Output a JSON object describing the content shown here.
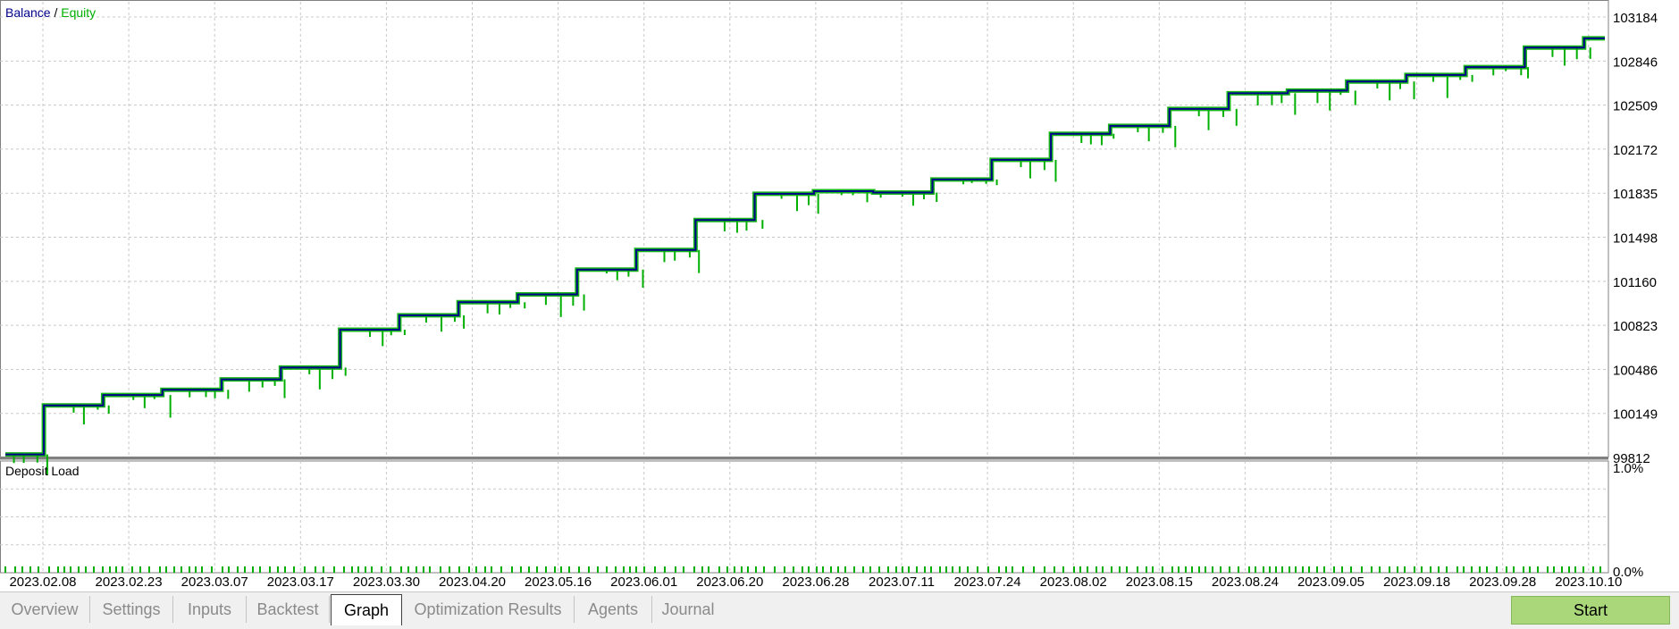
{
  "chart": {
    "legend": {
      "balance": "Balance",
      "sep": " / ",
      "equity": "Equity"
    },
    "colors": {
      "balance": "#00008b",
      "equity": "#00b000",
      "grid": "#c8c8c8",
      "separator": "#808080"
    },
    "subpanel_title": "Deposit Load",
    "subpanel_scale": [
      "1.0%",
      "0.0%"
    ]
  },
  "chart_data": {
    "type": "line",
    "series": [
      {
        "name": "Balance",
        "color": "#00008b"
      },
      {
        "name": "Equity",
        "color": "#00b000"
      }
    ],
    "y_ticks": [
      103184,
      102846,
      102509,
      102172,
      101835,
      101498,
      101160,
      100823,
      100486,
      100149,
      99812
    ],
    "ylim": [
      99812,
      103300
    ],
    "x_ticks": [
      "2023.02.08",
      "2023.02.23",
      "2023.03.07",
      "2023.03.17",
      "2023.03.30",
      "2023.04.20",
      "2023.05.16",
      "2023.06.01",
      "2023.06.20",
      "2023.06.28",
      "2023.07.11",
      "2023.07.24",
      "2023.08.02",
      "2023.08.15",
      "2023.08.24",
      "2023.09.05",
      "2023.09.18",
      "2023.09.28",
      "2023.10.10"
    ],
    "balance_by_tick": [
      99835,
      100210,
      100290,
      100330,
      100410,
      100500,
      100790,
      100900,
      101000,
      101060,
      101250,
      101400,
      101630,
      101830,
      101850,
      101840,
      101940,
      102090,
      102290,
      102350,
      102480,
      102600,
      102620,
      102690,
      102740,
      102800,
      102950,
      103020
    ],
    "deposit_load_range": [
      "0.0%",
      "1.0%"
    ]
  },
  "tabs": [
    {
      "label": "Overview",
      "active": false
    },
    {
      "label": "Settings",
      "active": false
    },
    {
      "label": "Inputs",
      "active": false
    },
    {
      "label": "Backtest",
      "active": false
    },
    {
      "label": "Graph",
      "active": true
    },
    {
      "label": "Optimization Results",
      "active": false
    },
    {
      "label": "Agents",
      "active": false
    },
    {
      "label": "Journal",
      "active": false
    }
  ],
  "start_button": "Start"
}
